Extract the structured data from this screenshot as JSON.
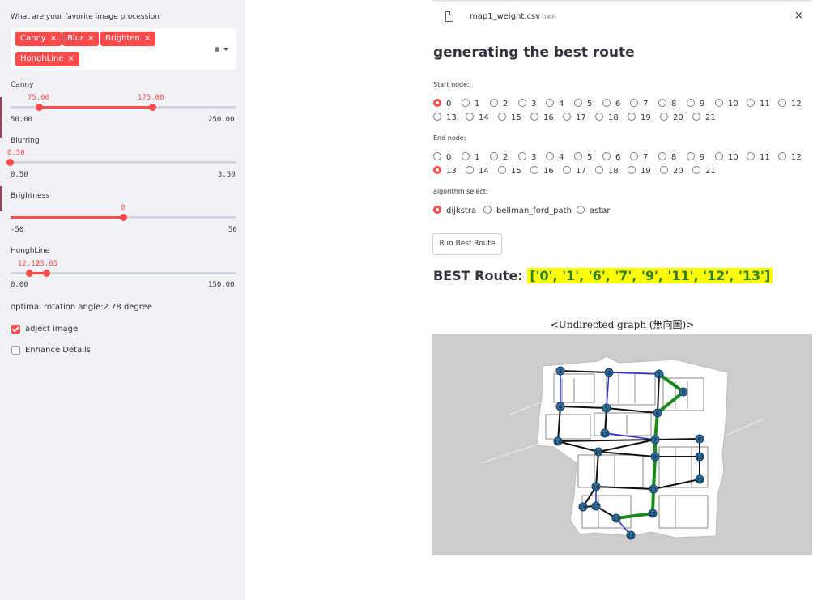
{
  "sidebar": {
    "multiselect_label": "What are your favorite image procession",
    "chips": [
      {
        "label": "Canny",
        "remove": "×"
      },
      {
        "label": "Blur",
        "remove": "×"
      },
      {
        "label": "Brighten",
        "remove": "×"
      },
      {
        "label": "HonghLine",
        "remove": "×"
      }
    ],
    "dropdown_icon": "chevron-down-icon",
    "sliders": {
      "canny": {
        "label": "Canny",
        "low": "75.00",
        "high": "175.00",
        "min": "50.00",
        "max": "250.00",
        "low_value": 75,
        "high_value": 175,
        "range": [
          50,
          250
        ]
      },
      "blurring": {
        "label": "Blurring",
        "value": "0.50",
        "min": "0.50",
        "max": "3.50",
        "numeric": 0.5,
        "range": [
          0.5,
          3.5
        ]
      },
      "brightness": {
        "label": "Brightness",
        "value": "0",
        "min": "-50",
        "max": "50",
        "numeric": 0,
        "range": [
          -50,
          50
        ]
      },
      "hongh": {
        "label": "HonghLine",
        "low": "12.12",
        "high": "23.63",
        "min": "0.00",
        "max": "150.00",
        "low_value": 12.12,
        "high_value": 23.63,
        "range": [
          0,
          150
        ]
      }
    },
    "rotation_text": "optimal rotation angle:2.78 degree",
    "checkboxes": [
      {
        "label": "adject image",
        "checked": true
      },
      {
        "label": "Enhance Details",
        "checked": false
      }
    ]
  },
  "main": {
    "file": {
      "name": "map1_weight.csv",
      "size": "1.1KB",
      "close": "×"
    },
    "heading": "generating the best route",
    "start_label": "Start node:",
    "end_label": "End node:",
    "nodes": [
      "0",
      "1",
      "2",
      "3",
      "4",
      "5",
      "6",
      "7",
      "8",
      "9",
      "10",
      "11",
      "12",
      "13",
      "14",
      "15",
      "16",
      "17",
      "18",
      "19",
      "20",
      "21"
    ],
    "start_selected": "0",
    "end_selected": "13",
    "algo_label": "algorithm select:",
    "algorithms": [
      "dijkstra",
      "bellman_ford_path",
      "astar"
    ],
    "algo_selected": "dijkstra",
    "run_button": "Run Best Route",
    "best_prefix": "BEST Route:",
    "best_value": "['0', '1', '6', '7', '9', '11', '12', '13']",
    "graph_title": "<Undirected graph (無向圖)>"
  },
  "colors": {
    "accent": "#ff4b4b",
    "route": "#1a8a1a",
    "edge": "#111111",
    "edge_alt": "#2a2ad0",
    "node": "#2f6f9f"
  }
}
